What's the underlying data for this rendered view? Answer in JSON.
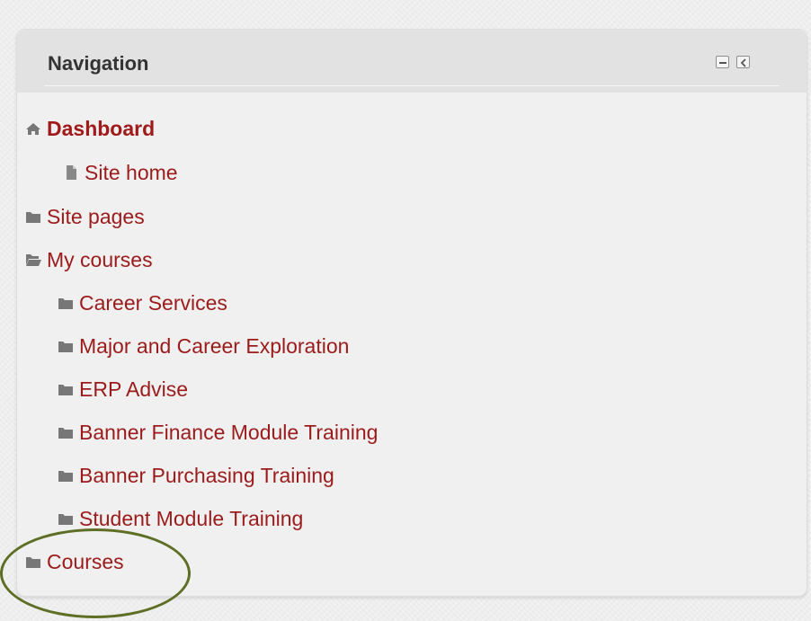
{
  "block": {
    "title": "Navigation",
    "controls": {
      "hide_icon": "minus-icon",
      "dock_icon": "chevron-left-icon"
    }
  },
  "nav": {
    "dashboard": {
      "label": "Dashboard",
      "icon": "home-icon"
    },
    "site_home": {
      "label": "Site home",
      "icon": "page-icon"
    },
    "site_pages": {
      "label": "Site pages",
      "icon": "folder-icon"
    },
    "my_courses": {
      "label": "My courses",
      "icon": "folder-open-icon"
    },
    "courses_list": [
      {
        "label": "Career Services",
        "icon": "folder-icon"
      },
      {
        "label": "Major and Career Exploration",
        "icon": "folder-icon"
      },
      {
        "label": "ERP Advise",
        "icon": "folder-icon"
      },
      {
        "label": "Banner Finance Module Training",
        "icon": "folder-icon"
      },
      {
        "label": "Banner Purchasing Training",
        "icon": "folder-icon"
      },
      {
        "label": "Student Module Training",
        "icon": "folder-icon"
      }
    ],
    "courses": {
      "label": "Courses",
      "icon": "folder-icon"
    }
  },
  "colors": {
    "link": "#9b1b1b",
    "dashboard": "#a01a1a",
    "title": "#333333",
    "icon": "#777777",
    "highlight": "#5e6e24",
    "block_bg": "#f0f0f0",
    "header_bg": "#e2e2e2"
  }
}
